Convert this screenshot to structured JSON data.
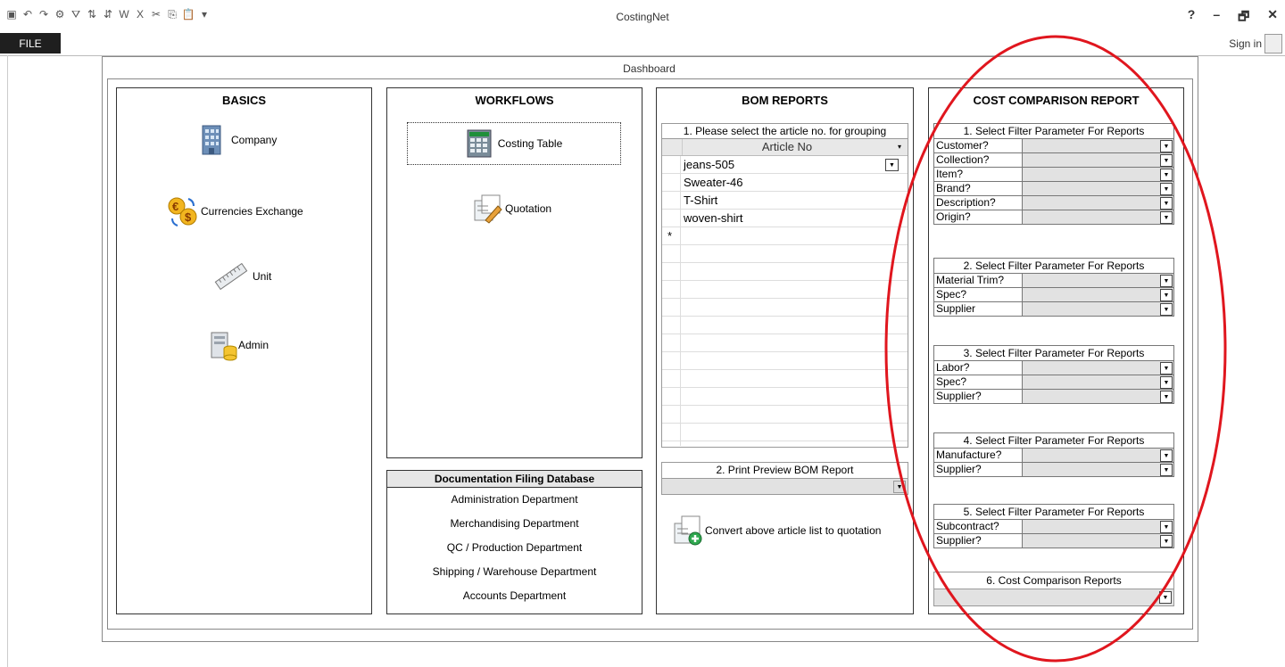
{
  "app": {
    "title": "CostingNet",
    "file_tab": "FILE",
    "sign_in": "Sign in",
    "help": "?",
    "minimize": "–",
    "restore": "🗗",
    "close": "✕"
  },
  "dashboard": {
    "title": "Dashboard"
  },
  "basics": {
    "title": "BASICS",
    "items": [
      {
        "label": "Company",
        "icon": "building-icon"
      },
      {
        "label": "Currencies Exchange",
        "icon": "currency-exchange-icon"
      },
      {
        "label": "Unit",
        "icon": "ruler-icon"
      },
      {
        "label": "Admin",
        "icon": "admin-database-icon"
      }
    ]
  },
  "workflows": {
    "title": "WORKFLOWS",
    "items": [
      {
        "label": "Costing Table",
        "icon": "costing-table-icon"
      },
      {
        "label": "Quotation",
        "icon": "quotation-icon"
      }
    ]
  },
  "documentation": {
    "title": "Documentation Filing Database",
    "items": [
      "Administration Department",
      "Merchandising Department",
      "QC / Production Department",
      "Shipping / Warehouse Department",
      "Accounts Department"
    ]
  },
  "bom": {
    "title": "BOM REPORTS",
    "select_label": "1. Please select the article no. for grouping",
    "column_header": "Article No",
    "articles": [
      "jeans-505",
      "Sweater-46",
      "T-Shirt",
      "woven-shirt"
    ],
    "new_row_marker": "*",
    "print_label": "2. Print Preview BOM Report",
    "convert_label": "Convert above article list to quotation"
  },
  "cost": {
    "title": "COST COMPARISON REPORT",
    "groups": [
      {
        "heading": "1. Select Filter Parameter For Reports",
        "fields": [
          "Customer?",
          "Collection?",
          "Item?",
          "Brand?",
          "Description?",
          "Origin?"
        ]
      },
      {
        "heading": "2. Select Filter Parameter For Reports",
        "fields": [
          "Material Trim?",
          "Spec?",
          "Supplier"
        ]
      },
      {
        "heading": "3. Select Filter Parameter For Reports",
        "fields": [
          "Labor?",
          "Spec?",
          "Supplier?"
        ]
      },
      {
        "heading": "4. Select Filter Parameter For Reports",
        "fields": [
          "Manufacture?",
          "Supplier?"
        ]
      },
      {
        "heading": "5. Select Filter Parameter For Reports",
        "fields": [
          "Subcontract?",
          "Supplier?"
        ]
      }
    ],
    "reports_label": "6. Cost Comparison Reports"
  },
  "colors": {
    "annotation": "#e0161e",
    "ribbon_dark": "#1f1f1f"
  }
}
